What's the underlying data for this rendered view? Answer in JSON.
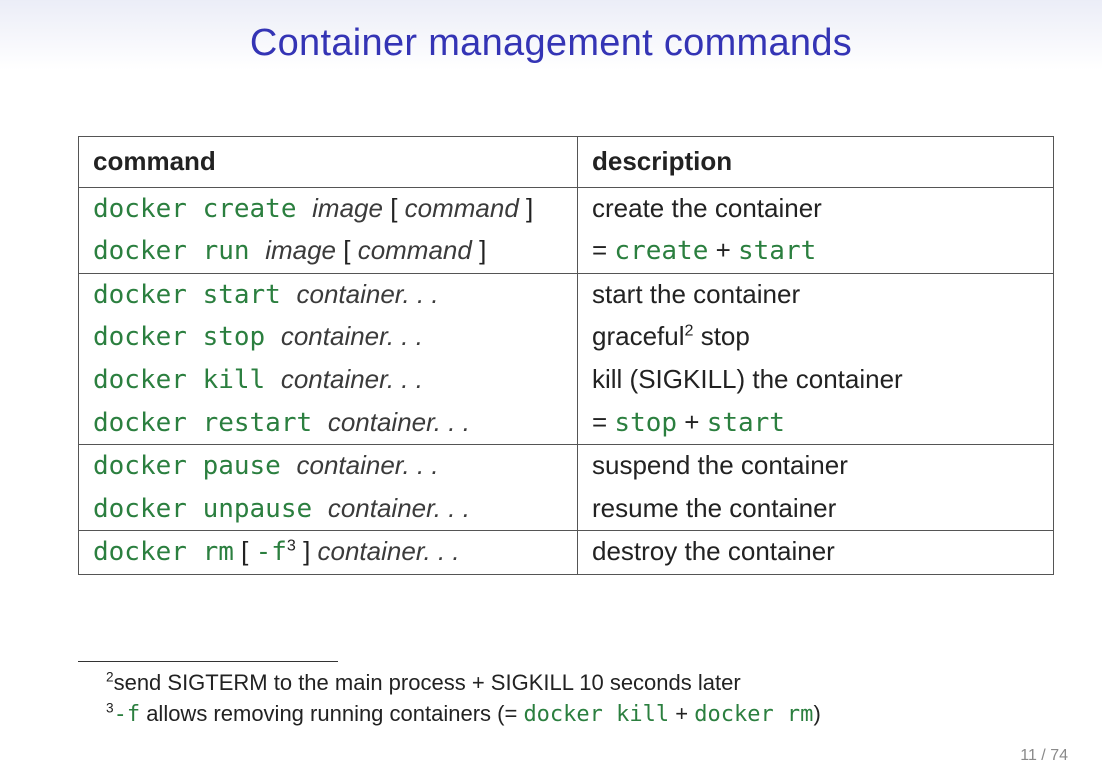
{
  "title": "Container management commands",
  "headers": {
    "command": "command",
    "description": "description"
  },
  "groups": [
    [
      {
        "tokens": [
          [
            "kw",
            "docker create "
          ],
          [
            "var",
            "image"
          ],
          [
            "sym",
            " [ "
          ],
          [
            "var",
            "command"
          ],
          [
            "sym",
            " ]"
          ]
        ],
        "desc": [
          [
            "txt",
            "create the container"
          ]
        ]
      },
      {
        "tokens": [
          [
            "kw",
            "docker run "
          ],
          [
            "var",
            "image"
          ],
          [
            "sym",
            " [ "
          ],
          [
            "var",
            "command"
          ],
          [
            "sym",
            " ]"
          ]
        ],
        "desc": [
          [
            "eq",
            "= "
          ],
          [
            "tt",
            "create"
          ],
          [
            "plus",
            " + "
          ],
          [
            "tt",
            "start"
          ]
        ]
      }
    ],
    [
      {
        "tokens": [
          [
            "kw",
            "docker start "
          ],
          [
            "var",
            "container. . ."
          ]
        ],
        "desc": [
          [
            "txt",
            "start the container"
          ]
        ]
      },
      {
        "tokens": [
          [
            "kw",
            "docker stop "
          ],
          [
            "var",
            "container. . ."
          ]
        ],
        "desc": [
          [
            "txt",
            "graceful"
          ],
          [
            "sup",
            "2"
          ],
          [
            "txt",
            " stop"
          ]
        ]
      },
      {
        "tokens": [
          [
            "kw",
            "docker kill "
          ],
          [
            "var",
            "container. . ."
          ]
        ],
        "desc": [
          [
            "txt",
            "kill (SIGKILL) the container"
          ]
        ]
      },
      {
        "tokens": [
          [
            "kw",
            "docker restart "
          ],
          [
            "var",
            "container. . ."
          ]
        ],
        "desc": [
          [
            "eq",
            "= "
          ],
          [
            "tt",
            "stop"
          ],
          [
            "plus",
            " + "
          ],
          [
            "tt",
            "start"
          ]
        ]
      }
    ],
    [
      {
        "tokens": [
          [
            "kw",
            "docker pause "
          ],
          [
            "var",
            "container. . ."
          ]
        ],
        "desc": [
          [
            "txt",
            "suspend the container"
          ]
        ]
      },
      {
        "tokens": [
          [
            "kw",
            "docker unpause "
          ],
          [
            "var",
            "container. . ."
          ]
        ],
        "desc": [
          [
            "txt",
            "resume the container"
          ]
        ]
      }
    ],
    [
      {
        "tokens": [
          [
            "kw",
            "docker rm"
          ],
          [
            "sym",
            " [ "
          ],
          [
            "tt",
            "-f"
          ],
          [
            "sup",
            "3"
          ],
          [
            "sym",
            " ] "
          ],
          [
            "var",
            "container. . ."
          ]
        ],
        "desc": [
          [
            "txt",
            "destroy the container"
          ]
        ]
      }
    ]
  ],
  "footnotes": [
    [
      [
        "sup",
        "2"
      ],
      [
        "txt",
        "send SIGTERM to the main process + SIGKILL 10 seconds later"
      ]
    ],
    [
      [
        "sup",
        "3"
      ],
      [
        "tt",
        "-f"
      ],
      [
        "txt",
        " allows removing running containers (= "
      ],
      [
        "tt",
        "docker kill"
      ],
      [
        "txt",
        " + "
      ],
      [
        "tt",
        "docker rm"
      ],
      [
        "txt",
        ")"
      ]
    ]
  ],
  "pagenum": "11 / 74"
}
